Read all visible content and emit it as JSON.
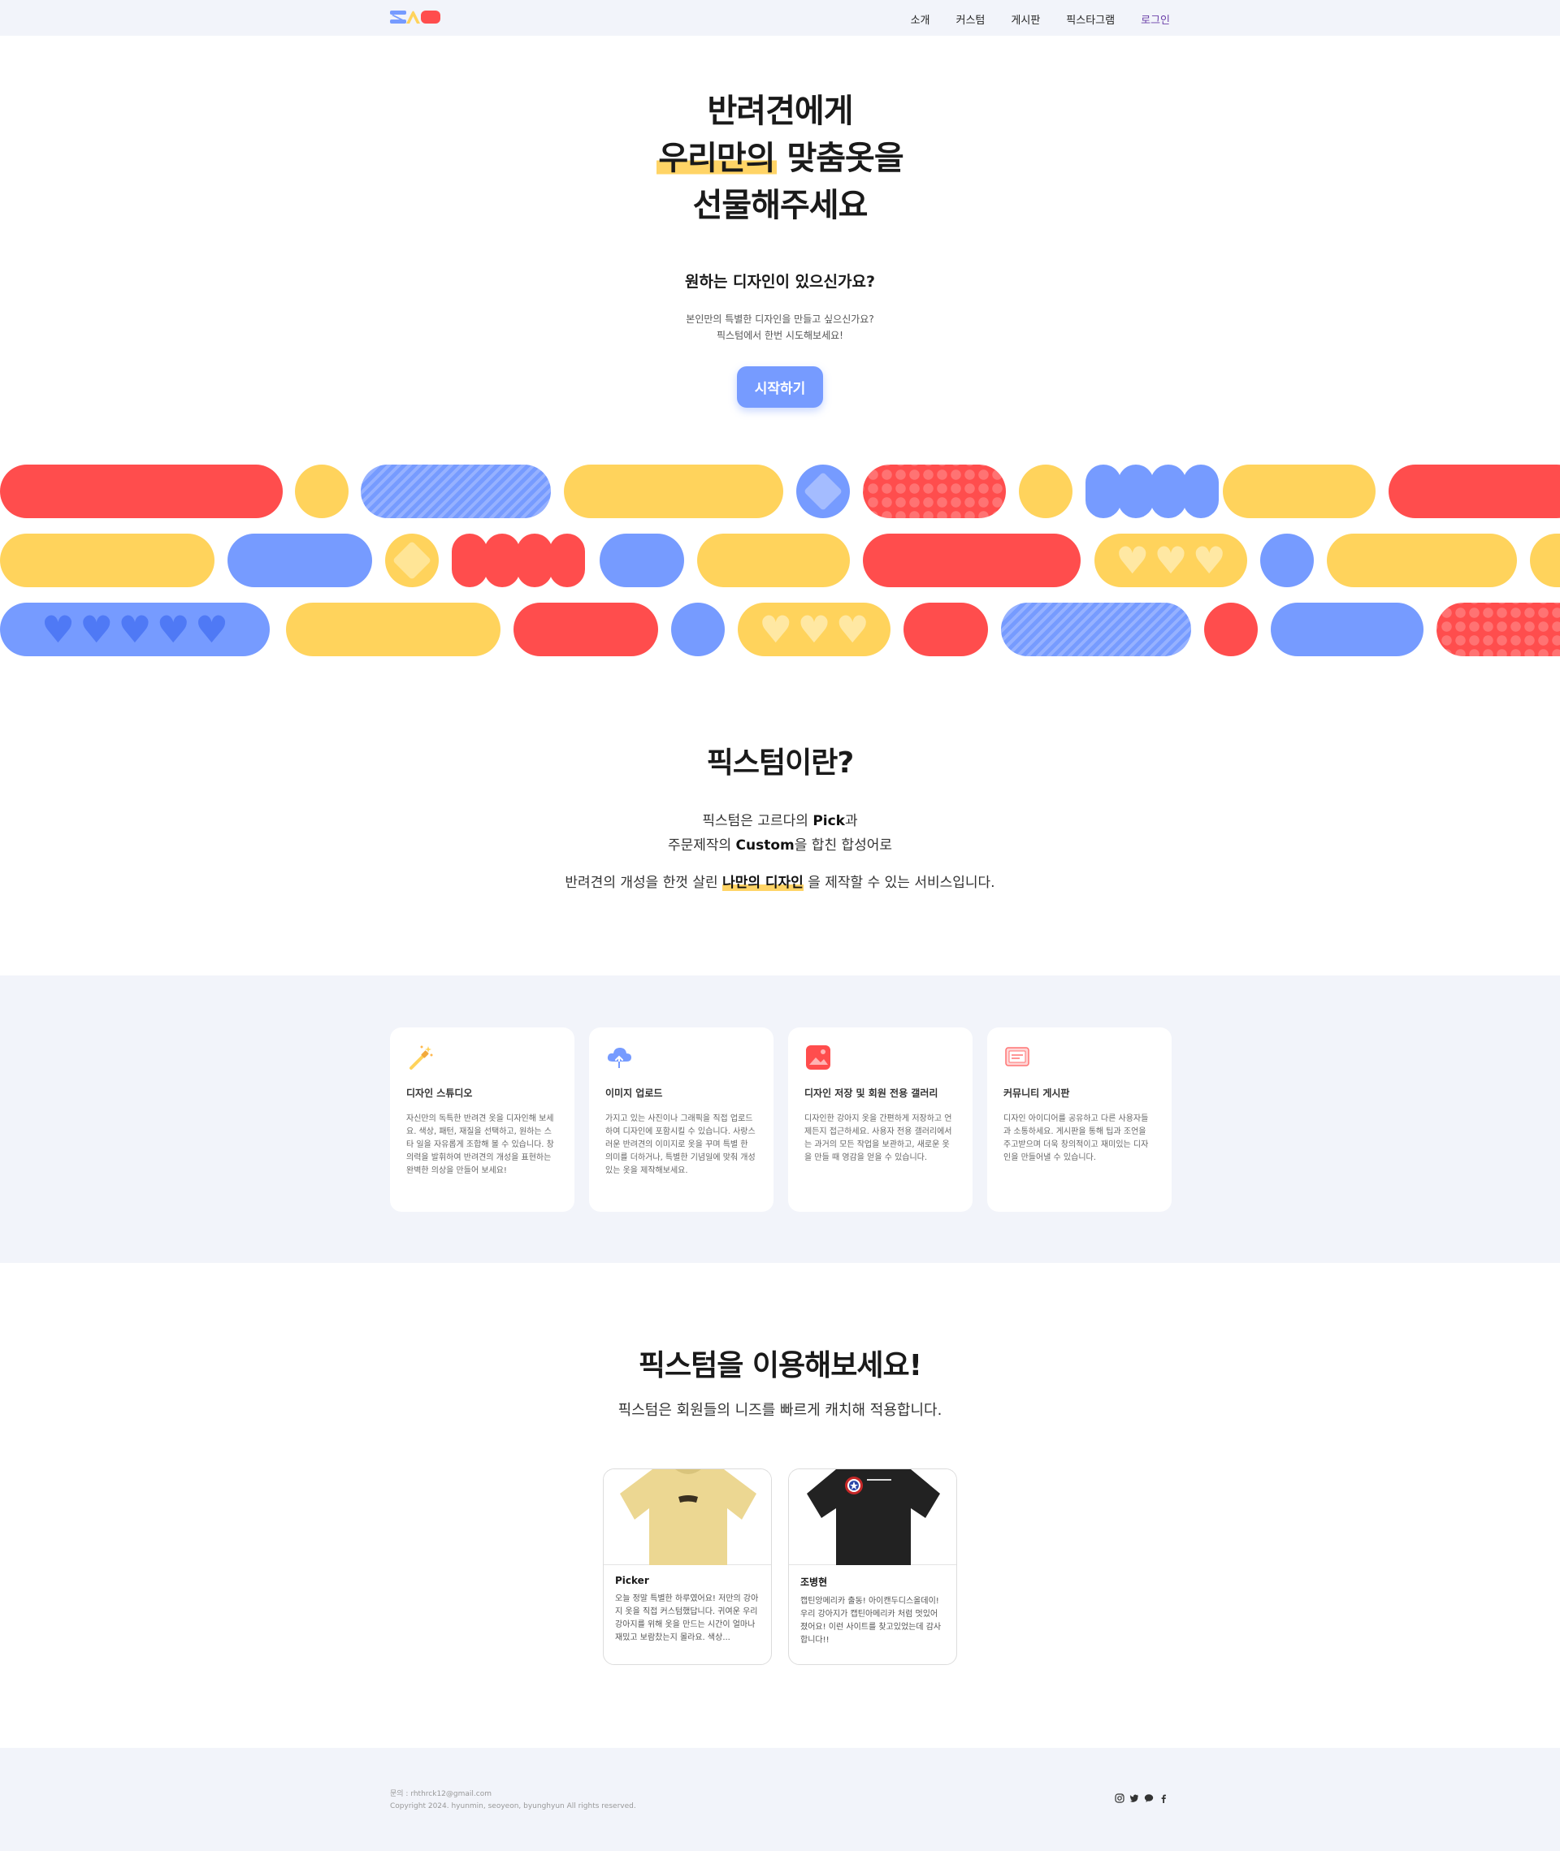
{
  "nav": {
    "logo_text": "",
    "menu": [
      "소개",
      "커스텀",
      "게시판",
      "픽스타그램"
    ],
    "login": "로그인"
  },
  "hero": {
    "line1": "반려견에게",
    "line2_hl": "우리만의",
    "line2_rest": " 맞춤옷을",
    "line3": "선물해주세요",
    "question": "원하는 디자인이 있으신가요?",
    "desc1": "본인만의 특별한 디자인을 만들고 싶으신가요?",
    "desc2": "픽스텀에서 한번 시도해보세요!",
    "cta": "시작하기"
  },
  "what": {
    "title": "픽스텀이란?",
    "l1a": "픽스텀은 고르다의 ",
    "l1b": "Pick",
    "l1c": "과",
    "l2a": "주문제작의 ",
    "l2b": "Custom",
    "l2c": "을 합친 합성어로",
    "l3a": "반려견의 개성을 한껏 살린 ",
    "l3b": "나만의 디자인",
    "l3c": " 을 제작할 수 있는 서비스입니다."
  },
  "features": [
    {
      "icon": "magic-wand-icon",
      "title": "디자인 스튜디오",
      "desc": "자신만의 독특한 반려견 옷을 디자인해 보세요. 색상, 패턴, 재질을 선택하고, 원하는 스타 일을 자유롭게 조합해 볼 수 있습니다. 창의력을 발휘하여 반려견의 개성을 표현하는 완벽한 의상을 만들어 보세요!"
    },
    {
      "icon": "cloud-upload-icon",
      "title": "이미지 업로드",
      "desc": "가지고 있는 사진이나 그래픽을 직접 업로드하여 디자인에 포함시킬 수 있습니다. 사랑스러운 반려견의 이미지로 옷을 꾸며 특별 한 의미를 더하거나, 특별한 기념일에 맞춰 개성 있는 옷을 제작해보세요."
    },
    {
      "icon": "gallery-icon",
      "title": "디자인 저장 및 회원 전용 갤러리",
      "desc": "디자인한 강아지 옷을 간편하게 저장하고 언제든지 접근하세요. 사용자 전용 갤러리에서는 과거의 모든 작업을 보관하고, 새로운 옷을 만들 때 영감을 얻을 수 있습니다."
    },
    {
      "icon": "board-icon",
      "title": "커뮤니티 게시판",
      "desc": "디자인 아이디어를 공유하고 다른 사용자들과 소통하세요. 게시판을 통해 팁과 조언을 주고받으며 더욱 창의적이고 재미있는 디자인을 만들어낼 수 있습니다."
    }
  ],
  "use": {
    "title": "픽스텀을 이용해보세요!",
    "sub": "픽스텀은 회원들의 니즈를 빠르게 캐치해 적용합니다."
  },
  "reviews": [
    {
      "name": "Picker",
      "text": "오늘 정말 특별한 하루였어요! 저만의 강아지 옷을 직접 커스텀했답니다. 귀여운 우리 강아지를 위해 옷을 만드는 시간이 얼마나 재밌고 보람찼는지 몰라요. 색상...",
      "shirt_color": "#ecd792",
      "shirt_name": "yellow-shirt-image"
    },
    {
      "name": "조병현",
      "text": "캡틴앙메리카 출동! 아이캔두디스올데이! 우리 강아지가 캡틴아메리카 처럼 멋있어졌어요! 이런 사이트를 찾고있었는데 감사합니다!!",
      "shirt_color": "#222222",
      "shirt_name": "black-shirt-image"
    }
  ],
  "footer": {
    "contact": "문의 : rhthrck12@gmail.com",
    "copyright": "Copyright 2024. hyunmin, seoyeon, byunghyun All rights reserved."
  },
  "colors": {
    "red": "#ff4d4d",
    "yellow": "#ffd35c",
    "blue": "#769bff",
    "bg": "#f2f4fa"
  }
}
